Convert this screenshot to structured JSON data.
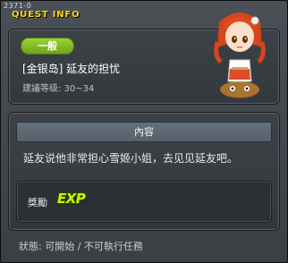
{
  "window": {
    "id_tag": "2371-0",
    "title": "QUEST INFO"
  },
  "quest": {
    "category": "一般",
    "name": "[金银岛] 延友的担忧",
    "level_text": "建議等级: 30~34"
  },
  "content": {
    "header": "內容",
    "description": "延友说他非常担心雪姬小姐，去见见延友吧。"
  },
  "reward": {
    "label": "獎勵",
    "exp_text": "EXP",
    "exp_color": "#c8f01a"
  },
  "status_text": "狀態: 可開始 / 不可執行任務",
  "colors": {
    "title": "#f5d418",
    "badge": "#8cc62c"
  }
}
